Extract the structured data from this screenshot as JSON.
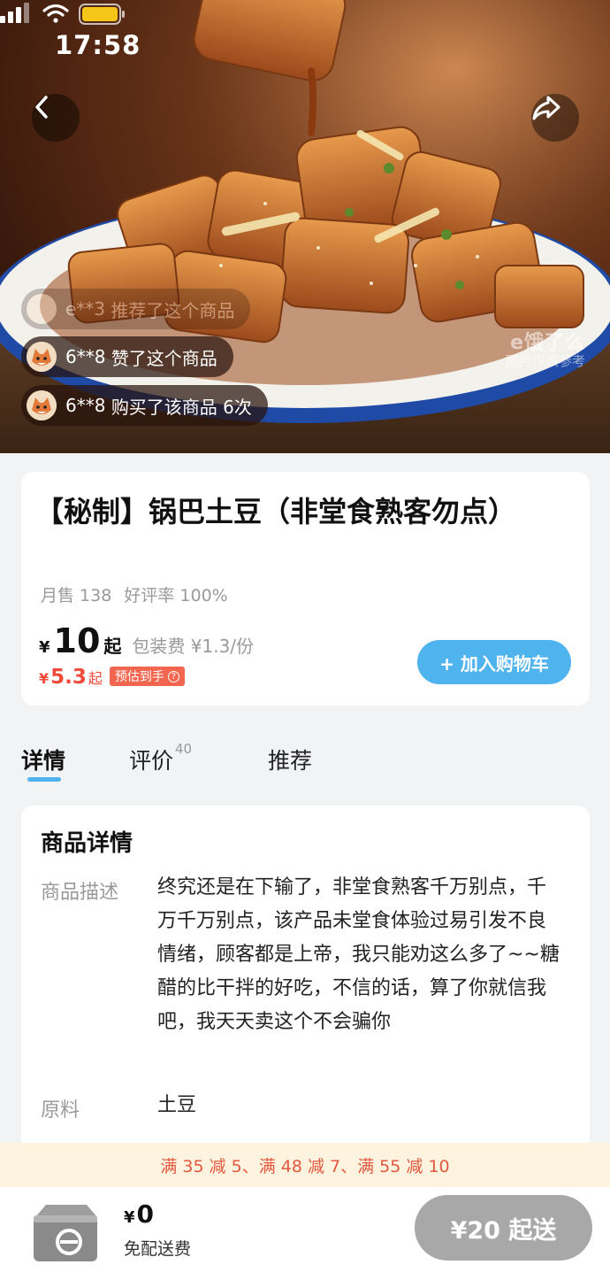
{
  "status_bar": {
    "time": "17:58"
  },
  "hero": {
    "activities": [
      {
        "user": "e**3",
        "action": "推荐了这个商品"
      },
      {
        "user": "6**8",
        "action": "赞了这个商品"
      },
      {
        "user": "6**8",
        "action": "购买了该商品 6次"
      }
    ],
    "watermark_brand": "e饿了么",
    "watermark_note": "图片仅供参考"
  },
  "product": {
    "title": "【秘制】锅巴土豆（非堂食熟客勿点）",
    "monthly_sales": "月售 138",
    "rating": "好评率 100%",
    "currency": "¥",
    "price": "10",
    "price_suffix": "起",
    "packing_fee": "包装费 ¥1.3/份",
    "est_currency": "¥",
    "est_price": "5.3",
    "est_suffix": "起",
    "est_badge": "预估到手",
    "est_badge_icon": "?",
    "add_to_cart": "+ 加入购物车"
  },
  "tabs": [
    {
      "label": "详情",
      "active": true
    },
    {
      "label": "评价",
      "count": "40"
    },
    {
      "label": "推荐"
    }
  ],
  "details": {
    "title": "商品详情",
    "description_label": "商品描述",
    "description": "终究还是在下输了，非堂食熟客千万别点，千万千万别点，该产品未堂食体验过易引发不良情绪，顾客都是上帝，我只能劝这么多了~~糖醋的比干拌的好吃，不信的话，算了你就信我吧，我天天卖这个不会骗你",
    "ingredients_label": "原料",
    "ingredients": "土豆"
  },
  "promo": "满 35 减 5、满 48 减 7、满 55 减 10",
  "bottom_bar": {
    "currency": "¥",
    "total": "0",
    "delivery": "免配送费",
    "min_order": "¥20 起送"
  },
  "colors": {
    "accent_blue": "#4fb3ee",
    "promo_red": "#e2583e",
    "price_red": "#f04a3a",
    "disabled_gray": "#a8a8a8"
  }
}
